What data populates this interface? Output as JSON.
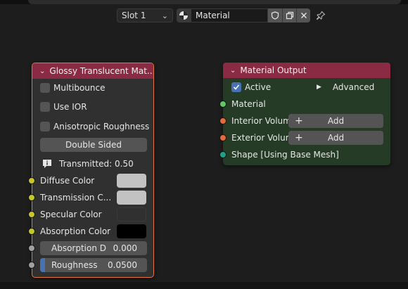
{
  "header": {
    "slot_label": "Slot 1",
    "material_name": "Material"
  },
  "glossy_node": {
    "title": "Glossy Translucent Mat...",
    "multibounce_label": "Multibounce",
    "use_ior_label": "Use IOR",
    "aniso_label": "Anisotropic Roughness",
    "double_sided_label": "Double Sided",
    "transmitted_label": "Transmitted: 0.50",
    "diffuse_color_label": "Diffuse Color",
    "transmission_color_label": "Transmission C...",
    "specular_color_label": "Specular Color",
    "absorption_color_label": "Absorption Color",
    "absorption_d_label": "Absorption D",
    "absorption_d_value": "0.000",
    "roughness_label": "Roughness",
    "roughness_value": "0.0500",
    "diffuse_color_hex": "#c2c2c2",
    "transmission_color_hex": "#c2c2c2",
    "specular_color_hex": "#303030",
    "absorption_color_hex": "#000000"
  },
  "output_node": {
    "title": "Material Output",
    "active_label": "Active",
    "advanced_label": "Advanced",
    "material_label": "Material",
    "interior_volume_label": "Interior Volume",
    "exterior_volume_label": "Exterior Volume",
    "add_label": "Add",
    "shape_label": "Shape [Using Base Mesh]"
  },
  "colors": {
    "node_header": "#8b2a43",
    "selected_outline": "#e07a3a",
    "socket_yellow": "#c7c729",
    "socket_gray": "#a1a1a1",
    "socket_green": "#63c763",
    "socket_orange": "#e5693c",
    "socket_teal": "#1fa187",
    "output_bg": "#263b26"
  }
}
